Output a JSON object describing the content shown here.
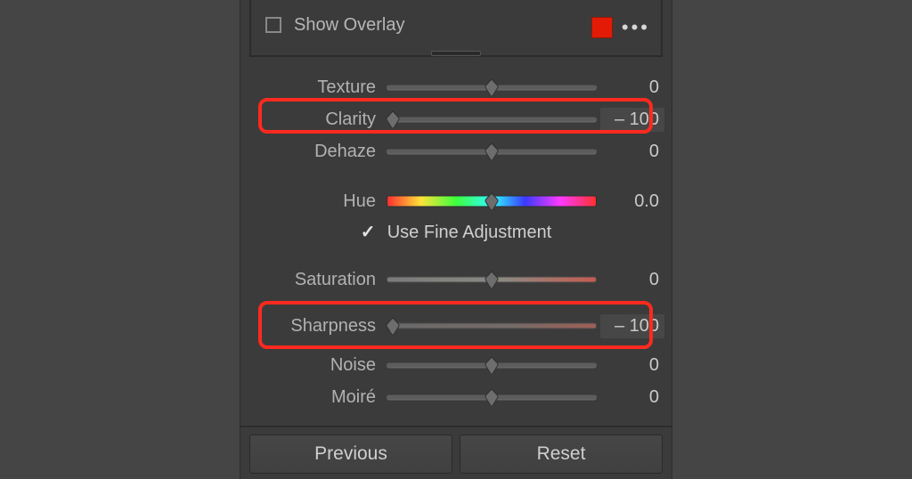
{
  "header": {
    "show_overlay_label": "Show Overlay",
    "overlay_checked": false,
    "swatch_color": "#e31b06"
  },
  "sliders": {
    "texture": {
      "label": "Texture",
      "value": "0",
      "pos": 50
    },
    "clarity": {
      "label": "Clarity",
      "value": "– 100",
      "pos": 3
    },
    "dehaze": {
      "label": "Dehaze",
      "value": "0",
      "pos": 50
    },
    "hue": {
      "label": "Hue",
      "value": "0.0",
      "pos": 50
    },
    "fine_label": "Use Fine Adjustment",
    "fine_checked": true,
    "saturation": {
      "label": "Saturation",
      "value": "0",
      "pos": 50
    },
    "sharpness": {
      "label": "Sharpness",
      "value": "– 100",
      "pos": 3
    },
    "noise": {
      "label": "Noise",
      "value": "0",
      "pos": 50
    },
    "moire": {
      "label": "Moiré",
      "value": "0",
      "pos": 50
    }
  },
  "footer": {
    "previous": "Previous",
    "reset": "Reset"
  }
}
